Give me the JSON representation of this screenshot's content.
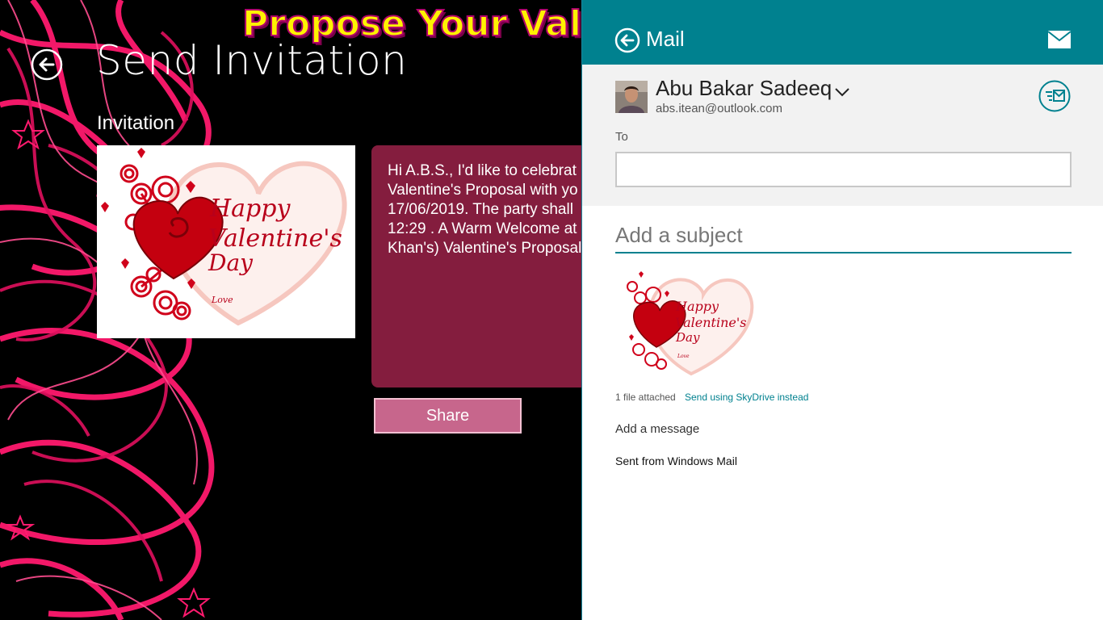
{
  "app": {
    "banner": "Propose Your Valen",
    "title": "Send Invitation",
    "section_label": "Invitation",
    "card": {
      "heading_line1": "Happy",
      "heading_line2": "Valentine's",
      "heading_line3": "Day",
      "signature": "Love"
    },
    "message": "Hi A.B.S., I'd like to celebrat\nValentine's Proposal with yo\n17/06/2019. The party shall\n12:29 . A Warm Welcome at\nKhan's) Valentine's Proposal",
    "share_label": "Share",
    "colors": {
      "accent_pink": "#ff1a6e",
      "message_bg": "#841d3e",
      "share_bg": "#c7668c"
    }
  },
  "mail": {
    "title": "Mail",
    "sender_name": "Abu Bakar Sadeeq",
    "sender_email": "abs.itean@outlook.com",
    "to_label": "To",
    "to_value": "",
    "subject_placeholder": "Add a subject",
    "attachment": {
      "heading_line1": "Happy",
      "heading_line2": "Valentine's",
      "heading_line3": "Day",
      "signature": "Love"
    },
    "attach_count": "1 file attached",
    "skydrive_link": "Send using SkyDrive instead",
    "add_message": "Add a message",
    "signature": "Sent from Windows Mail",
    "icons": {
      "back": "back-arrow-circle-icon",
      "envelope": "envelope-icon",
      "send": "send-mail-icon",
      "chevron": "chevron-down-icon"
    },
    "colors": {
      "header": "#00818f",
      "accent": "#00818f"
    }
  }
}
